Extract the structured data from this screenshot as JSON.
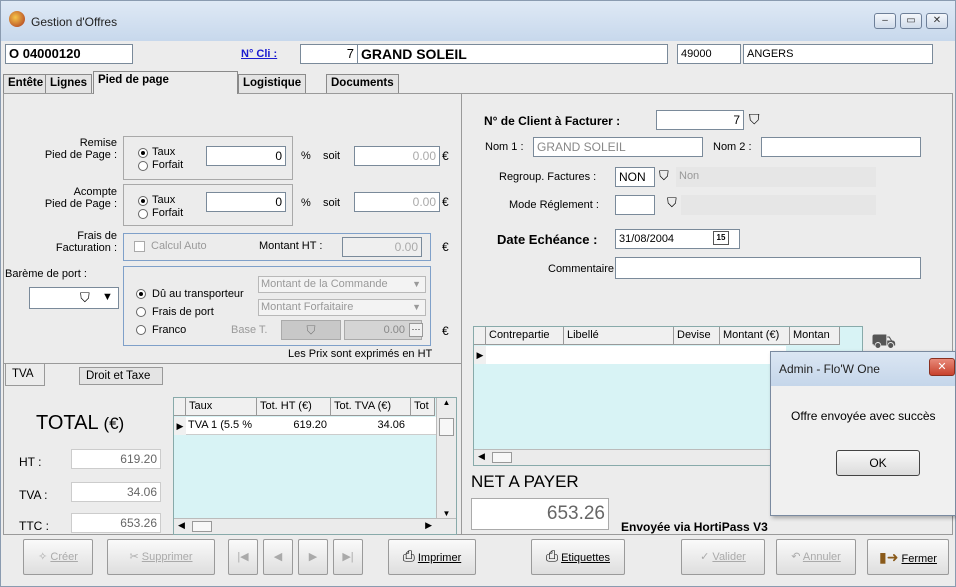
{
  "window": {
    "title": "Gestion d'Offres",
    "min": "–",
    "max": "▭",
    "close": "✕"
  },
  "header": {
    "offer_number": "O 04000120",
    "client_link": "N° Cli :",
    "client_number": "7",
    "client_name": "GRAND SOLEIL",
    "postal_code": "49000",
    "city": "ANGERS"
  },
  "tabs": [
    {
      "label": "Entête"
    },
    {
      "label": "Lignes"
    },
    {
      "label": "Pied de page"
    },
    {
      "label": "Logistique"
    },
    {
      "label": "Documents"
    }
  ],
  "left": {
    "remise_label": "Remise\nPied de Page :",
    "taux": "Taux",
    "forfait": "Forfait",
    "remise_value": "0",
    "percent": "%",
    "soit": "soit",
    "remise_amount": "0.00",
    "euro": "€",
    "acompte_label": "Acompte\nPied de Page :",
    "acompte_value": "0",
    "acompte_amount": "0.00",
    "frais_label": "Frais de\nFacturation :",
    "calcul_auto": "Calcul Auto",
    "montant_ht_label": "Montant HT :",
    "montant_ht_value": "0.00",
    "bareme_label": "Barème de port :",
    "du_transporteur": "Dû au transporteur",
    "frais_port": "Frais de port",
    "franco": "Franco",
    "base_t": "Base T.",
    "montant_commande": "Montant de la Commande",
    "montant_forfaitaire": "Montant Forfaitaire",
    "franco_value": "0.00",
    "prix_note": "Les Prix sont exprimés en HT"
  },
  "tva_tabs": [
    {
      "label": "TVA"
    },
    {
      "label": "Droit et Taxe"
    }
  ],
  "totals": {
    "title": "TOTAL",
    "unit": "(€)",
    "ht_label": "HT :",
    "ht": "619.20",
    "tva_label": "TVA :",
    "tva": "34.06",
    "ttc_label": "TTC :",
    "ttc": "653.26"
  },
  "tva_grid": {
    "headers": [
      "Taux",
      "Tot. HT (€)",
      "Tot. TVA (€)",
      "Tot"
    ],
    "rows": [
      [
        "TVA 1 (5.5 %",
        "619.20",
        "34.06",
        ""
      ]
    ]
  },
  "right": {
    "client_facturer_label": "N° de Client à Facturer :",
    "client_facturer": "7",
    "nom1_label": "Nom 1 :",
    "nom1": "GRAND SOLEIL",
    "nom2_label": "Nom 2 :",
    "nom2": "",
    "regroup_label": "Regroup. Factures :",
    "regroup_code": "NON",
    "regroup_text": "Non",
    "mode_label": "Mode Réglement :",
    "mode_code": "",
    "mode_text": "",
    "echeance_label": "Date Echéance :",
    "echeance": "31/08/2004",
    "calendar": "15",
    "commentaire_label": "Commentaire :",
    "commentaire": ""
  },
  "contrepartie_grid": {
    "headers": [
      "Contrepartie",
      "Libellé",
      "Devise",
      "Montant (€)",
      "Montan"
    ]
  },
  "net": {
    "label": "NET A PAYER",
    "value": "653.26",
    "status": "Envoyée via HortiPass V3"
  },
  "toolbar": {
    "creer": "Créer",
    "supprimer": "Supprimer",
    "imprimer": "Imprimer",
    "etiquettes": "Etiquettes",
    "valider": "Valider",
    "annuler": "Annuler",
    "fermer": "Fermer"
  },
  "dialog": {
    "title": "Admin - Flo'W One",
    "message": "Offre envoyée avec succès",
    "ok": "OK",
    "close": "✕"
  }
}
